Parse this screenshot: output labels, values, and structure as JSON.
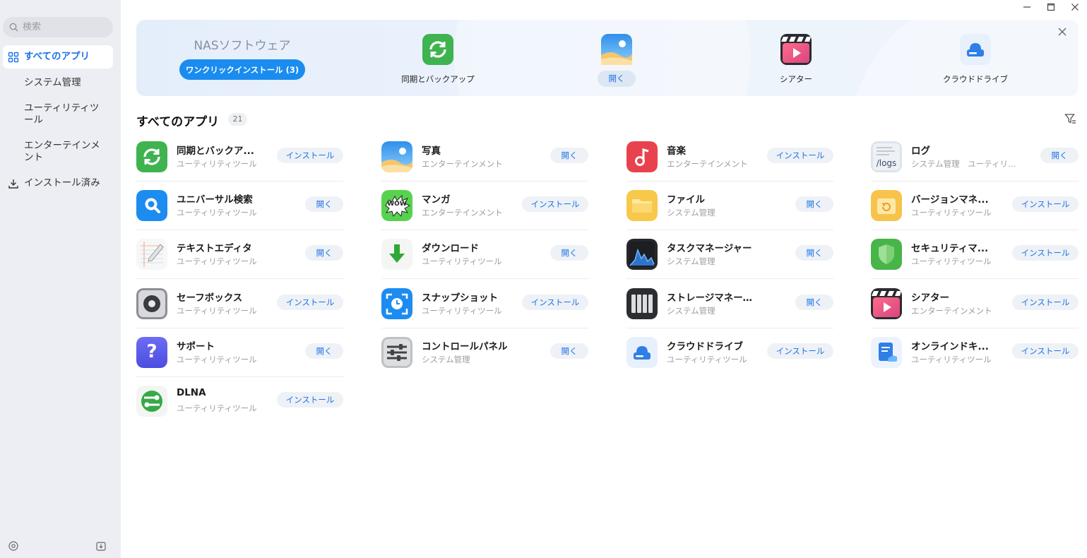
{
  "window": {
    "minimize": "—",
    "maximize": "☐",
    "close": "✕"
  },
  "sidebar": {
    "search_placeholder": "検索",
    "items": [
      {
        "label": "すべてのアプリ",
        "icon": "grid-icon",
        "active": true
      },
      {
        "label": "システム管理"
      },
      {
        "label": "ユーティリティツール"
      },
      {
        "label": "エンターテインメント"
      },
      {
        "label": "インストール済み",
        "icon": "download-icon"
      }
    ]
  },
  "banner": {
    "title": "NASソフトウェア",
    "button": "ワンクリックインストール (3)",
    "features": [
      {
        "label": "同期とバックアップ",
        "icon": "sync-icon"
      },
      {
        "label": "開く",
        "icon": "photos-icon",
        "is_button": true
      },
      {
        "label": "シアター",
        "icon": "theater-icon"
      },
      {
        "label": "クラウドドライブ",
        "icon": "cloud-drive-icon"
      }
    ]
  },
  "section": {
    "title": "すべてのアプリ",
    "count": "21"
  },
  "apps": [
    {
      "name": "同期とバックア...",
      "category": "ユーティリティツール",
      "action": "インストール",
      "icon": "sync-icon"
    },
    {
      "name": "写真",
      "category": "エンターテインメント",
      "action": "開く",
      "icon": "photos-icon"
    },
    {
      "name": "音楽",
      "category": "エンターテインメント",
      "action": "インストール",
      "icon": "music-icon"
    },
    {
      "name": "ログ",
      "category": "システム管理　ユーティリティツール",
      "action": "開く",
      "icon": "logs-icon",
      "icon_text": "/logs"
    },
    {
      "name": "ユニバーサル検索",
      "category": "ユーティリティツール",
      "action": "開く",
      "icon": "universal-search-icon"
    },
    {
      "name": "マンガ",
      "category": "エンターテインメント",
      "action": "インストール",
      "icon": "manga-icon",
      "icon_text": "WOW"
    },
    {
      "name": "ファイル",
      "category": "システム管理",
      "action": "開く",
      "icon": "folder-icon"
    },
    {
      "name": "バージョンマネ...",
      "category": "ユーティリティツール",
      "action": "インストール",
      "icon": "version-manager-icon"
    },
    {
      "name": "テキストエディタ",
      "category": "ユーティリティツール",
      "action": "開く",
      "icon": "text-editor-icon"
    },
    {
      "name": "ダウンロード",
      "category": "ユーティリティツール",
      "action": "開く",
      "icon": "download-app-icon"
    },
    {
      "name": "タスクマネージャー",
      "category": "システム管理",
      "action": "開く",
      "icon": "task-manager-icon"
    },
    {
      "name": "セキュリティマ...",
      "category": "ユーティリティツール",
      "action": "インストール",
      "icon": "shield-icon"
    },
    {
      "name": "セーフボックス",
      "category": "ユーティリティツール",
      "action": "インストール",
      "icon": "safebox-icon"
    },
    {
      "name": "スナップショット",
      "category": "ユーティリティツール",
      "action": "インストール",
      "icon": "snapshot-icon"
    },
    {
      "name": "ストレージマネージャー",
      "category": "システム管理",
      "action": "開く",
      "icon": "storage-manager-icon"
    },
    {
      "name": "シアター",
      "category": "エンターテインメント",
      "action": "インストール",
      "icon": "theater-icon"
    },
    {
      "name": "サポート",
      "category": "ユーティリティツール",
      "action": "開く",
      "icon": "support-icon",
      "icon_text": "?"
    },
    {
      "name": "コントロールパネル",
      "category": "システム管理",
      "action": "開く",
      "icon": "control-panel-icon"
    },
    {
      "name": "クラウドドライブ",
      "category": "ユーティリティツール",
      "action": "インストール",
      "icon": "cloud-drive-icon"
    },
    {
      "name": "オンラインドキ...",
      "category": "ユーティリティツール",
      "action": "インストール",
      "icon": "online-docs-icon"
    },
    {
      "name": "DLNA",
      "category": "ユーティリティツール",
      "action": "インストール",
      "icon": "dlna-icon"
    }
  ]
}
